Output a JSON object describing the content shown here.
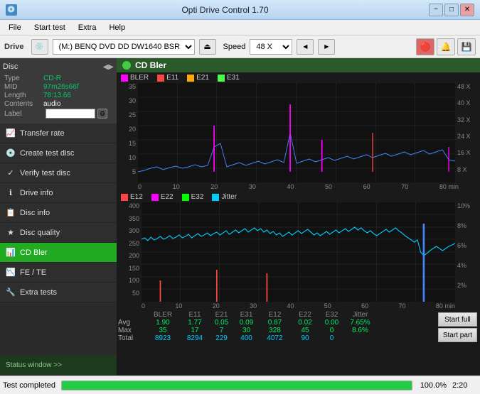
{
  "titlebar": {
    "icon": "💿",
    "title": "Opti Drive Control 1.70",
    "minimize": "−",
    "maximize": "□",
    "close": "✕"
  },
  "menubar": {
    "items": [
      "File",
      "Start test",
      "Extra",
      "Help"
    ]
  },
  "drivebar": {
    "drive_label": "Drive",
    "drive_value": "(M:)  BENQ DVD DD DW1640 BSRB",
    "speed_label": "Speed",
    "speed_value": "48 X",
    "eject_icon": "⏏"
  },
  "disc": {
    "header": "Disc",
    "type_label": "Type",
    "type_value": "CD-R",
    "mid_label": "MID",
    "mid_value": "97m26s66f",
    "length_label": "Length",
    "length_value": "78:13.66",
    "contents_label": "Contents",
    "contents_value": "audio",
    "label_label": "Label",
    "label_value": ""
  },
  "sidebar": {
    "items": [
      {
        "id": "transfer-rate",
        "label": "Transfer rate",
        "icon": "📈"
      },
      {
        "id": "create-test-disc",
        "label": "Create test disc",
        "icon": "💿"
      },
      {
        "id": "verify-test-disc",
        "label": "Verify test disc",
        "icon": "✓"
      },
      {
        "id": "drive-info",
        "label": "Drive info",
        "icon": "ℹ"
      },
      {
        "id": "disc-info",
        "label": "Disc info",
        "icon": "📋"
      },
      {
        "id": "disc-quality",
        "label": "Disc quality",
        "icon": "★"
      },
      {
        "id": "cd-bler",
        "label": "CD Bler",
        "icon": "📊",
        "active": true
      },
      {
        "id": "fe-te",
        "label": "FE / TE",
        "icon": "📉"
      },
      {
        "id": "extra-tests",
        "label": "Extra tests",
        "icon": "🔧"
      }
    ],
    "status_window": "Status window >>"
  },
  "chart_top": {
    "title": "CD Bler",
    "icon": "●",
    "legend": [
      {
        "id": "BLER",
        "color": "#ff00ff",
        "label": "BLER"
      },
      {
        "id": "E11",
        "color": "#ff4444",
        "label": "E11"
      },
      {
        "id": "E21",
        "color": "#ffaa00",
        "label": "E21"
      },
      {
        "id": "E31",
        "color": "#44ff44",
        "label": "E31"
      }
    ],
    "y_axis": [
      "35",
      "30",
      "25",
      "20",
      "15",
      "10",
      "5",
      ""
    ],
    "y_axis_right": [
      "48 X",
      "40 X",
      "32 X",
      "24 X",
      "16 X",
      "8 X",
      ""
    ],
    "x_axis": [
      "0",
      "10",
      "20",
      "30",
      "40",
      "50",
      "60",
      "70",
      "80 min"
    ]
  },
  "chart_bottom": {
    "legend": [
      {
        "id": "E12",
        "color": "#ff4444",
        "label": "E12"
      },
      {
        "id": "E22",
        "color": "#ff00ff",
        "label": "E22"
      },
      {
        "id": "E32",
        "color": "#00ff00",
        "label": "E32"
      },
      {
        "id": "Jitter",
        "color": "#00ccff",
        "label": "Jitter"
      }
    ],
    "y_axis": [
      "400",
      "350",
      "300",
      "250",
      "200",
      "150",
      "100",
      "50",
      ""
    ],
    "y_axis_right": [
      "10%",
      "8%",
      "6%",
      "4%",
      "2%",
      ""
    ],
    "x_axis": [
      "0",
      "10",
      "20",
      "30",
      "40",
      "50",
      "60",
      "70",
      "80 min"
    ]
  },
  "stats": {
    "columns": [
      "",
      "BLER",
      "E11",
      "E21",
      "E31",
      "E12",
      "E22",
      "E32",
      "Jitter",
      ""
    ],
    "avg_label": "Avg",
    "avg_values": [
      "1.90",
      "1.77",
      "0.05",
      "0.09",
      "0.87",
      "0.02",
      "0.00",
      "7.65%"
    ],
    "max_label": "Max",
    "max_values": [
      "35",
      "17",
      "7",
      "30",
      "328",
      "45",
      "0",
      "8.6%"
    ],
    "total_label": "Total",
    "total_values": [
      "8923",
      "8294",
      "229",
      "400",
      "4072",
      "90",
      "0",
      ""
    ],
    "start_full": "Start full",
    "start_part": "Start part"
  },
  "statusbar": {
    "label": "Test completed",
    "progress": 100,
    "pct": "100.0%",
    "time": "2:20"
  },
  "colors": {
    "sidebar_bg": "#2a2a2a",
    "sidebar_active": "#22aa22",
    "chart_bg": "#111111",
    "bler_color": "#ff00ff",
    "e11_color": "#ff4444",
    "e21_color": "#ffaa00",
    "e31_color": "#44ff44",
    "e12_color": "#ff4444",
    "jitter_color": "#00ccff",
    "blue_line": "#4488ff"
  }
}
